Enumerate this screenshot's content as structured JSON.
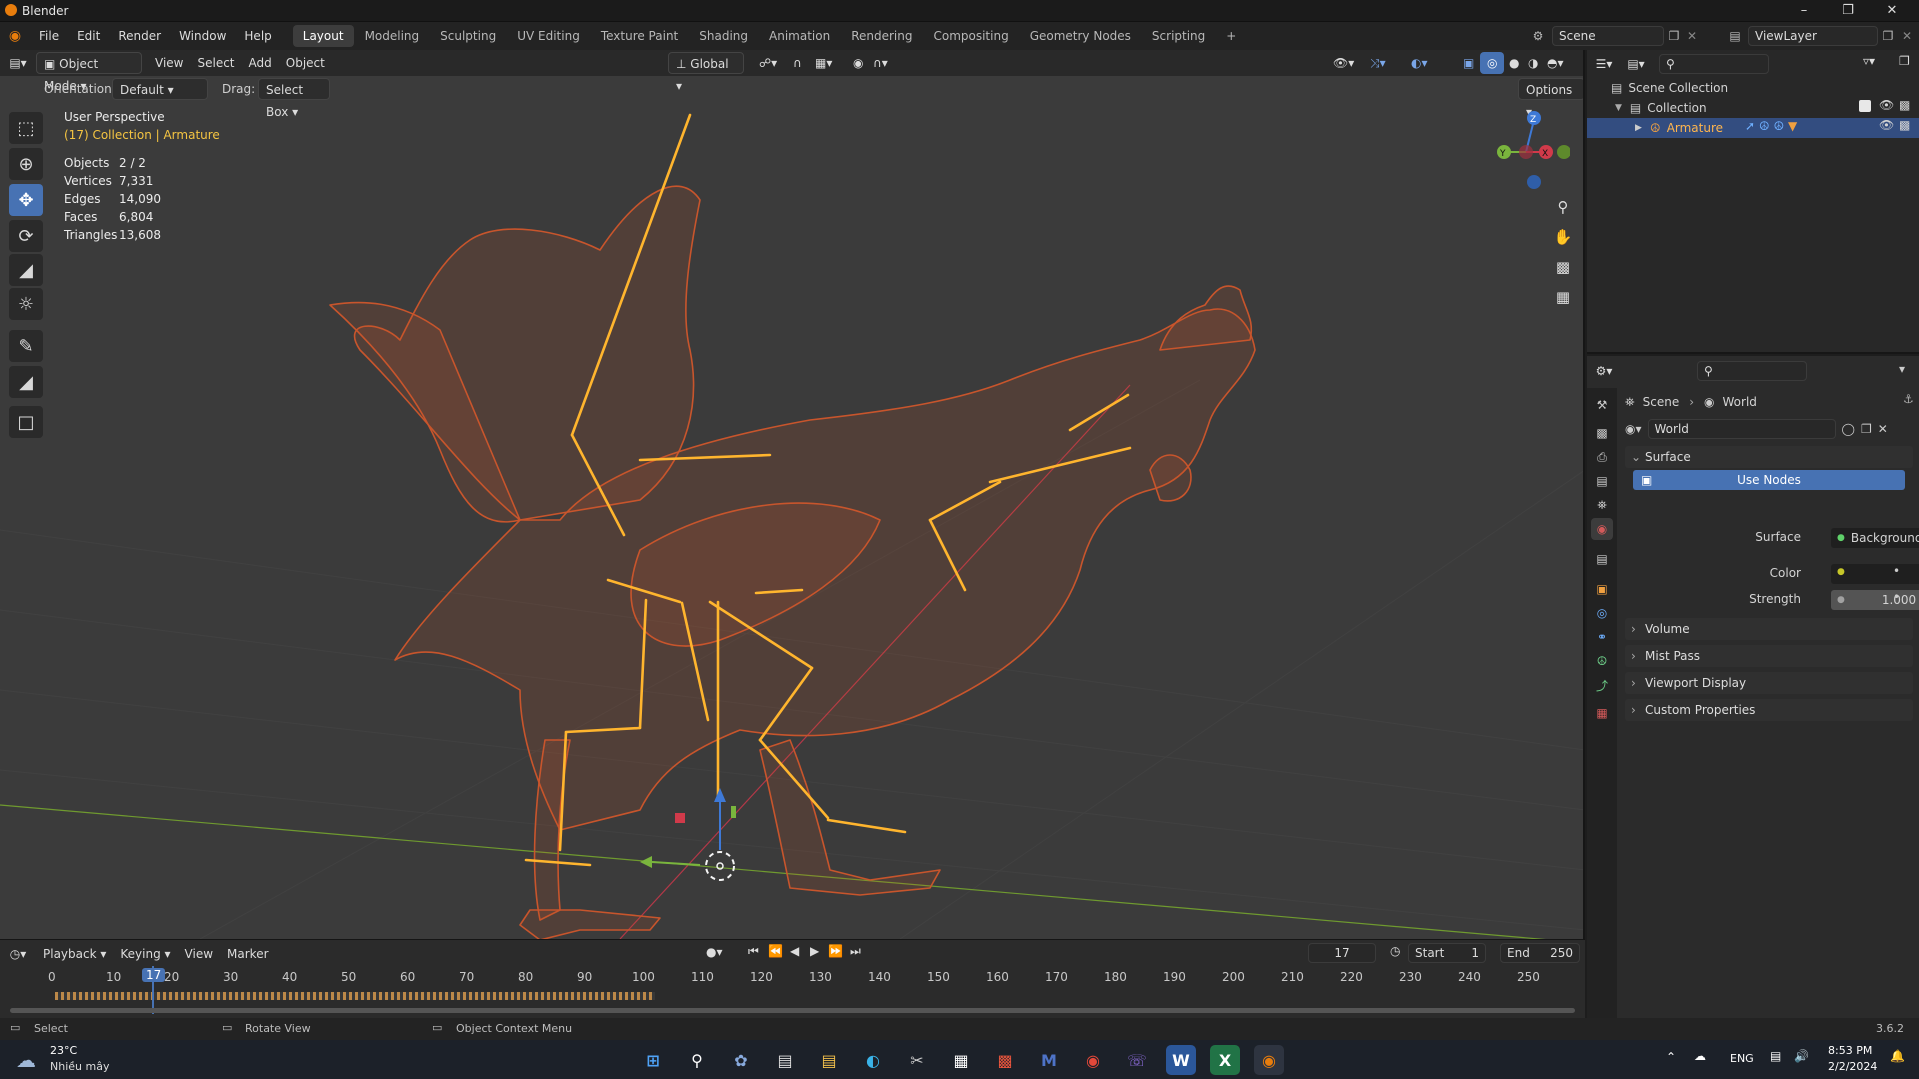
{
  "app": {
    "title": "Blender",
    "version": "3.6.2"
  },
  "colors": {
    "accent": "#4772b3",
    "wire": "#c8552c",
    "bone": "#ffb52e",
    "x_axis": "#d13a4a",
    "y_axis": "#7ab53d",
    "z_axis": "#3e79d6",
    "viewport_bg": "#3b3b3b"
  },
  "menubar": {
    "menus": [
      "File",
      "Edit",
      "Render",
      "Window",
      "Help"
    ],
    "workspaces": [
      "Layout",
      "Modeling",
      "Sculpting",
      "UV Editing",
      "Texture Paint",
      "Shading",
      "Animation",
      "Rendering",
      "Compositing",
      "Geometry Nodes",
      "Scripting"
    ],
    "active_workspace": "Layout",
    "add_workspace": "+",
    "scene": "Scene",
    "view_layer": "ViewLayer"
  },
  "viewport": {
    "mode": "Object Mode",
    "menus": [
      "View",
      "Select",
      "Add",
      "Object"
    ],
    "transform_orientation": "Global",
    "orientation_label": "Orientation:",
    "orientation_value": "Default",
    "drag_label": "Drag:",
    "drag_value": "Select Box",
    "options": "Options",
    "view_name": "User Perspective",
    "active_info": "(17) Collection | Armature",
    "stats": [
      {
        "label": "Objects",
        "value": "2 / 2"
      },
      {
        "label": "Vertices",
        "value": "7,331"
      },
      {
        "label": "Edges",
        "value": "14,090"
      },
      {
        "label": "Faces",
        "value": "6,804"
      },
      {
        "label": "Triangles",
        "value": "13,608"
      }
    ],
    "gizmo": {
      "z": "Z",
      "y": "Y",
      "x": "X"
    }
  },
  "timeline": {
    "menus": [
      "Playback",
      "Keying",
      "View",
      "Marker"
    ],
    "current_frame": "17",
    "start_label": "Start",
    "start": "1",
    "end_label": "End",
    "end": "250",
    "ticks": [
      "0",
      "10",
      "20",
      "30",
      "40",
      "50",
      "60",
      "70",
      "80",
      "90",
      "100",
      "110",
      "120",
      "130",
      "140",
      "150",
      "160",
      "170",
      "180",
      "190",
      "200",
      "210",
      "220",
      "230",
      "240",
      "250"
    ],
    "playhead_label": "17"
  },
  "outliner": {
    "root": "Scene Collection",
    "collection": "Collection",
    "object": "Armature"
  },
  "properties": {
    "breadcrumb_scene": "Scene",
    "breadcrumb_world": "World",
    "world_name": "World",
    "surface_panel": "Surface",
    "use_nodes": "Use Nodes",
    "surface_label": "Surface",
    "surface_value": "Background",
    "color_label": "Color",
    "strength_label": "Strength",
    "strength_value": "1.000",
    "panels": [
      "Volume",
      "Mist Pass",
      "Viewport Display",
      "Custom Properties"
    ]
  },
  "statusbar": {
    "select": "Select",
    "rotate": "Rotate View",
    "context": "Object Context Menu",
    "version": "3.6.2"
  },
  "taskbar": {
    "weather_temp": "23°C",
    "weather_desc": "Nhiều mây",
    "lang": "ENG",
    "time": "8:53 PM",
    "date": "2/2/2024"
  }
}
